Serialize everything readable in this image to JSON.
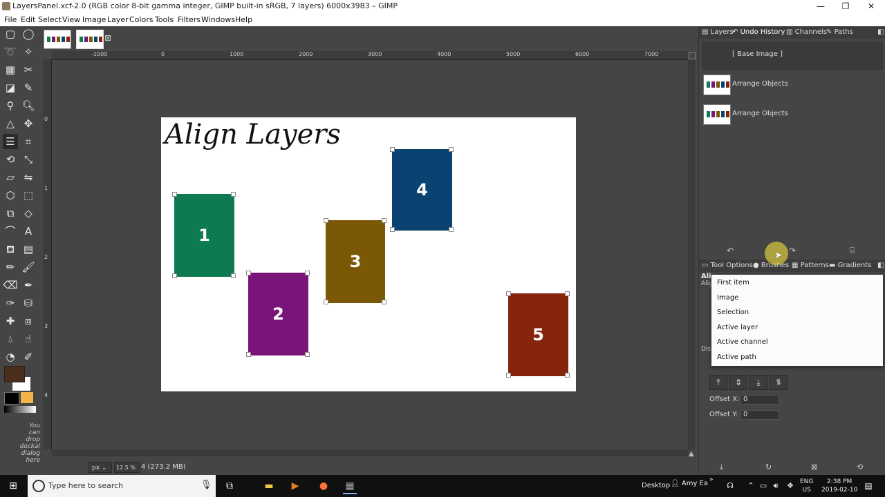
{
  "window": {
    "title": "LayersPanel.xcf-2.0 (RGB color 8-bit gamma integer, GIMP built-in sRGB, 7 layers) 6000x3983 – GIMP",
    "minimize": "—",
    "restore": "❐",
    "close": "✕"
  },
  "menu": [
    "File",
    "Edit",
    "Select",
    "View",
    "Image",
    "Layer",
    "Colors",
    "Tools",
    "Filters",
    "Windows",
    "Help"
  ],
  "image_tabs": {
    "close": "⊠"
  },
  "ruler": {
    "h_ticks": [
      "-1000",
      "0",
      "1000",
      "2000",
      "3000",
      "4000",
      "5000",
      "6000",
      "7000"
    ],
    "v_ticks": [
      "0",
      "1",
      "2",
      "3",
      "4"
    ]
  },
  "canvas": {
    "title": "Align Layers",
    "boxes": [
      {
        "label": "1",
        "color": "#0e7a52"
      },
      {
        "label": "2",
        "color": "#7a1478"
      },
      {
        "label": "3",
        "color": "#7a5806"
      },
      {
        "label": "4",
        "color": "#0a4272"
      },
      {
        "label": "5",
        "color": "#86240e"
      }
    ]
  },
  "toolbox": {
    "fg_color": "#4a2e1c",
    "bg_color": "#ffffff",
    "hint": [
      "You",
      "can",
      "drop",
      "dockal",
      "dialog",
      "here"
    ]
  },
  "statusbar": {
    "unit": "px",
    "zoom": "12.5 %",
    "info": "4 (273.2 MB)"
  },
  "dock_top": {
    "tabs": [
      "Layers",
      "Undo History",
      "Channels",
      "Paths"
    ],
    "history": [
      "[ Base Image ]",
      "Arrange Objects",
      "Arrange Objects"
    ]
  },
  "dock_bottom": {
    "tabs": [
      "Tool Options",
      "Brushes",
      "Patterns",
      "Gradients"
    ],
    "partial_labels": [
      "Ali",
      "Alig",
      "Dis"
    ],
    "dropdown": [
      "First item",
      "Image",
      "Selection",
      "Active layer",
      "Active channel",
      "Active path"
    ],
    "offset_x": {
      "label": "Offset X:",
      "value": "0"
    },
    "offset_y": {
      "label": "Offset Y:",
      "value": "0"
    }
  },
  "taskbar": {
    "search_placeholder": "Type here to search",
    "desktop": "Desktop",
    "user": "Amy Ea",
    "lang": "ENG",
    "region": "US",
    "time": "2:38 PM",
    "date": "2019-02-10"
  }
}
